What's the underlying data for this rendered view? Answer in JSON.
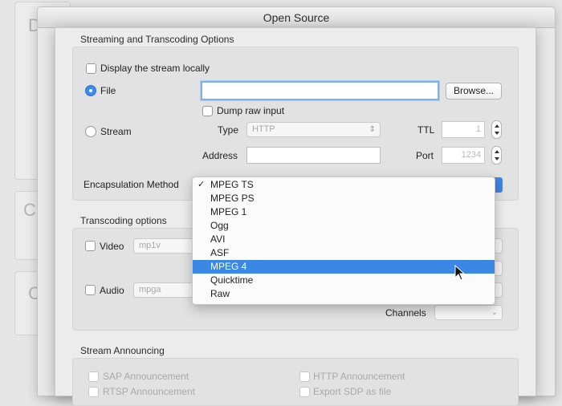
{
  "window": {
    "title": "Open Source"
  },
  "background_windows": {
    "letters": [
      "D",
      "Cl",
      "C"
    ]
  },
  "streaming": {
    "section_title": "Streaming and Transcoding Options",
    "display_locally_label": "Display the stream locally",
    "file_label": "File",
    "file_path_value": "",
    "browse_label": "Browse...",
    "dump_raw_label": "Dump raw input",
    "stream_label": "Stream",
    "type_label": "Type",
    "type_value": "HTTP",
    "ttl_label": "TTL",
    "ttl_value": "1",
    "address_label": "Address",
    "address_value": "",
    "port_label": "Port",
    "port_value": "1234",
    "encapsulation_label": "Encapsulation Method",
    "encapsulation_options": [
      "MPEG TS",
      "MPEG PS",
      "MPEG 1",
      "Ogg",
      "AVI",
      "ASF",
      "MPEG 4",
      "Quicktime",
      "Raw"
    ],
    "checked_option": "MPEG TS",
    "highlighted_option": "MPEG 4"
  },
  "transcoding": {
    "section_title": "Transcoding options",
    "video_label": "Video",
    "video_codec": "mp1v",
    "audio_label": "Audio",
    "audio_codec": "mpga",
    "channels_label": "Channels"
  },
  "announcing": {
    "section_title": "Stream Announcing",
    "sap_label": "SAP Announcement",
    "rtsp_label": "RTSP Announcement",
    "http_label": "HTTP Announcement",
    "export_sdp_label": "Export SDP as file"
  },
  "colors": {
    "accent": "#3a87e6",
    "selection_text": "#ffffff"
  }
}
